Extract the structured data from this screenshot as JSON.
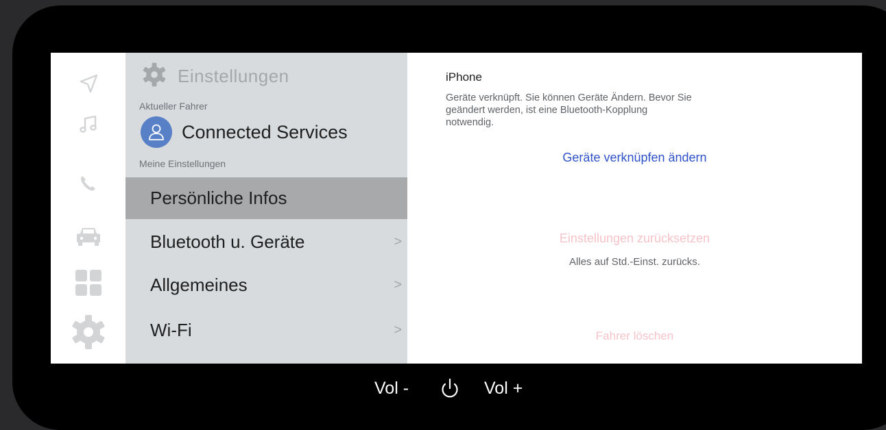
{
  "icons": {
    "rail": [
      "navigation-icon",
      "music-icon",
      "phone-icon",
      "car-icon",
      "apps-grid-icon",
      "settings-gear-icon"
    ],
    "header": "settings-gear-icon",
    "avatar": "user-icon",
    "power": "power-icon"
  },
  "colors": {
    "accent_link": "#2f52c9",
    "destructive_disabled": "#f6c3c9",
    "avatar_bg": "#5780c6",
    "panel_bg": "#d8dbdd",
    "selected_bg": "#a7a9ab"
  },
  "settings": {
    "title": "Einstellungen",
    "current_driver_label": "Aktueller Fahrer",
    "driver_name": "Connected Services",
    "my_settings_label": "Meine Einstellungen",
    "menu": [
      {
        "label": "Persönliche Infos",
        "chevron": "",
        "selected": true
      },
      {
        "label": "Bluetooth u. Geräte",
        "chevron": ">",
        "selected": false
      },
      {
        "label": "Allgemeines",
        "chevron": ">",
        "selected": false
      },
      {
        "label": "Wi-Fi",
        "chevron": ">",
        "selected": false
      }
    ]
  },
  "detail": {
    "device_name": "iPhone",
    "device_description": "Geräte verknüpft. Sie können Geräte Ändern. Bevor Sie geändert werden, ist eine Bluetooth-Kopplung notwendig.",
    "pair_button": "Geräte verknüpfen ändern",
    "reset_button": "Einstellungen zurücksetzen",
    "reset_subtitle": "Alles auf Std.-Einst. zurücks.",
    "delete_button": "Fahrer löschen"
  },
  "controls": {
    "vol_minus": "Vol -",
    "vol_plus": "Vol +"
  }
}
